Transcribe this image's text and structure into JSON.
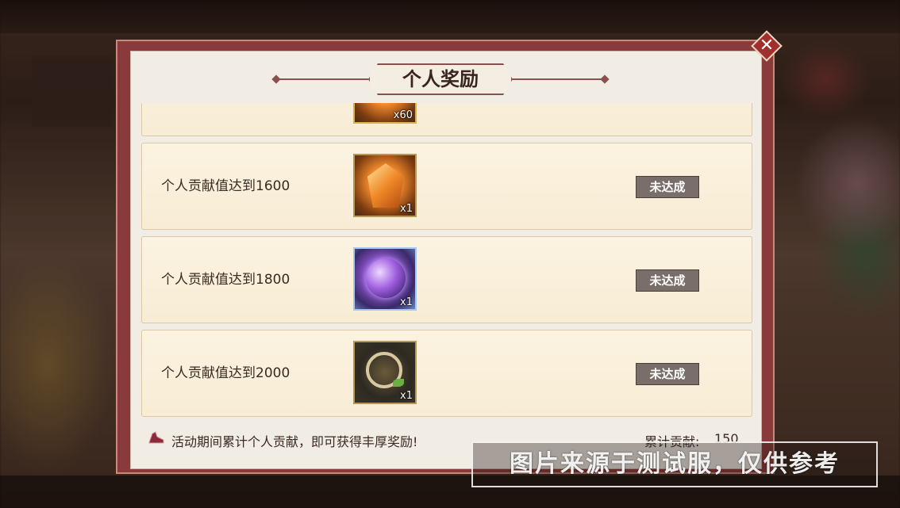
{
  "dialog": {
    "title": "个人奖励",
    "close_icon": "close-icon"
  },
  "rewards": [
    {
      "label": "",
      "quantity": "x60",
      "icon": "gold-token-icon",
      "status": ""
    },
    {
      "label": "个人贡献值达到1600",
      "quantity": "x1",
      "icon": "orange-crystal-icon",
      "status": "未达成"
    },
    {
      "label": "个人贡献值达到1800",
      "quantity": "x1",
      "icon": "purple-orb-icon",
      "status": "未达成"
    },
    {
      "label": "个人贡献值达到2000",
      "quantity": "x1",
      "icon": "jade-ring-icon",
      "status": "未达成"
    }
  ],
  "footer": {
    "description": "活动期间累计个人贡献，即可获得丰厚奖励!",
    "total_label": "累计贡献:",
    "total_value": "150",
    "icon": "shoe-icon"
  },
  "watermark": "图片来源于测试服，仅供参考",
  "colors": {
    "frame": "#8a3a3a",
    "row_bg": "#fbf3e1",
    "status_button": "#7a6e6a"
  }
}
